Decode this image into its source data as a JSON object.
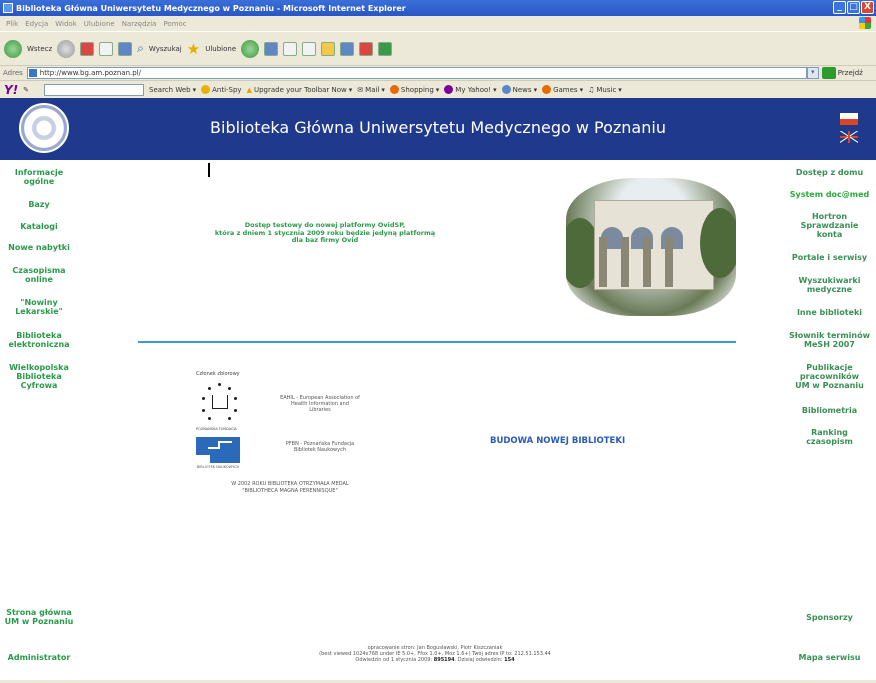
{
  "window": {
    "title": "Biblioteka Główna Uniwersytetu Medycznego w Poznaniu - Microsoft Internet Explorer",
    "buttons": {
      "minimize": "_",
      "maximize": "□",
      "close": "X"
    }
  },
  "menu": [
    "Plik",
    "Edycja",
    "Widok",
    "Ulubione",
    "Narzędzia",
    "Pomoc"
  ],
  "toolbar": {
    "back": "Wstecz",
    "search": "Wyszukaj",
    "favorites": "Ulubione"
  },
  "address": {
    "label": "Adres",
    "url": "http://www.bg.am.poznan.pl/",
    "go": "Przejdź"
  },
  "yahoo_toolbar": {
    "logo": "Y!",
    "items": [
      "Search Web",
      "Anti-Spy",
      "Upgrade your Toolbar Now",
      "Mail",
      "Shopping",
      "My Yahoo!",
      "News",
      "Games",
      "Music"
    ]
  },
  "banner": {
    "title": "Biblioteka Główna Uniwersytetu Medycznego w Poznaniu"
  },
  "nav_left": [
    {
      "label": "Informacje",
      "label2": "ogólne"
    },
    {
      "label": "Bazy"
    },
    {
      "label": "Katalogi"
    },
    {
      "label": "Nowe nabytki"
    },
    {
      "label": "Czasopisma",
      "label2": "online"
    },
    {
      "label": "\"Nowiny",
      "label2": "Lekarskie\""
    },
    {
      "label": "Biblioteka",
      "label2": "elektroniczna"
    },
    {
      "label": "Wielkopolska",
      "label2": "Biblioteka",
      "label3": "Cyfrowa"
    }
  ],
  "nav_left_bottom": [
    {
      "label": "Strona główna",
      "label2": "UM w Poznaniu"
    },
    {
      "label": "Administrator"
    }
  ],
  "nav_right": [
    {
      "label": "Dostęp z domu"
    },
    {
      "label": "System doc@med"
    },
    {
      "label": "Hortron",
      "label2": "Sprawdzanie",
      "label3": "konta"
    },
    {
      "label": "Portale i serwisy"
    },
    {
      "label": "Wyszukiwarki",
      "label2": "medyczne"
    },
    {
      "label": "Inne biblioteki"
    },
    {
      "label": "Słownik terminów",
      "label2": "MeSH 2007"
    },
    {
      "label": "Publikacje",
      "label2": "pracowników",
      "label3": "UM w Poznaniu"
    },
    {
      "label": "Bibliometria"
    },
    {
      "label": "Ranking",
      "label2": "czasopism"
    }
  ],
  "nav_right_bottom": [
    {
      "label": "Sponsorzy"
    },
    {
      "label": "Mapa serwisu"
    }
  ],
  "news": {
    "line1": "Dostęp testowy do nowej platformy OvidSP,",
    "line2": "która z dniem 1 stycznia 2009 roku będzie jedyną platformą",
    "line3": "dla baz firmy Ovid"
  },
  "logos": {
    "member_label": "Członek zbiorowy",
    "eahil_caption": "POZNAŃSKA FUNDACJA",
    "eahil_text": "EAHIL - European Association of Health Information and Libraries",
    "pfbn_caption": "BIBLIOTEK NAUKOWYCH",
    "pfbn_text": "PFBN - Poznańska Fundacja Bibliotek Naukowych",
    "medal_line1": "W 2002 ROKU BIBLIOTEKA OTRZYMAŁA MEDAL",
    "medal_line2": "\"BIBLIOTHECA MAGNA PERENNISQUE\""
  },
  "budowa": "BUDOWA NOWEJ BIBLIOTEKI",
  "footer": {
    "line1": "opracowanie stron: Jan Bogusławski, Piotr Kiszczaniak",
    "line2": "(best viewed 1024x768 under IE 5.0+, Ffox 1.0+, Moz 1.6+) Twój adres IP to: 212.51.153.44",
    "line3_prefix": "Odwiedzin od 1 stycznia 2009:",
    "count1": "895194",
    "line3_mid": ". Dzisiaj odwiedzin:",
    "count2": "154"
  }
}
